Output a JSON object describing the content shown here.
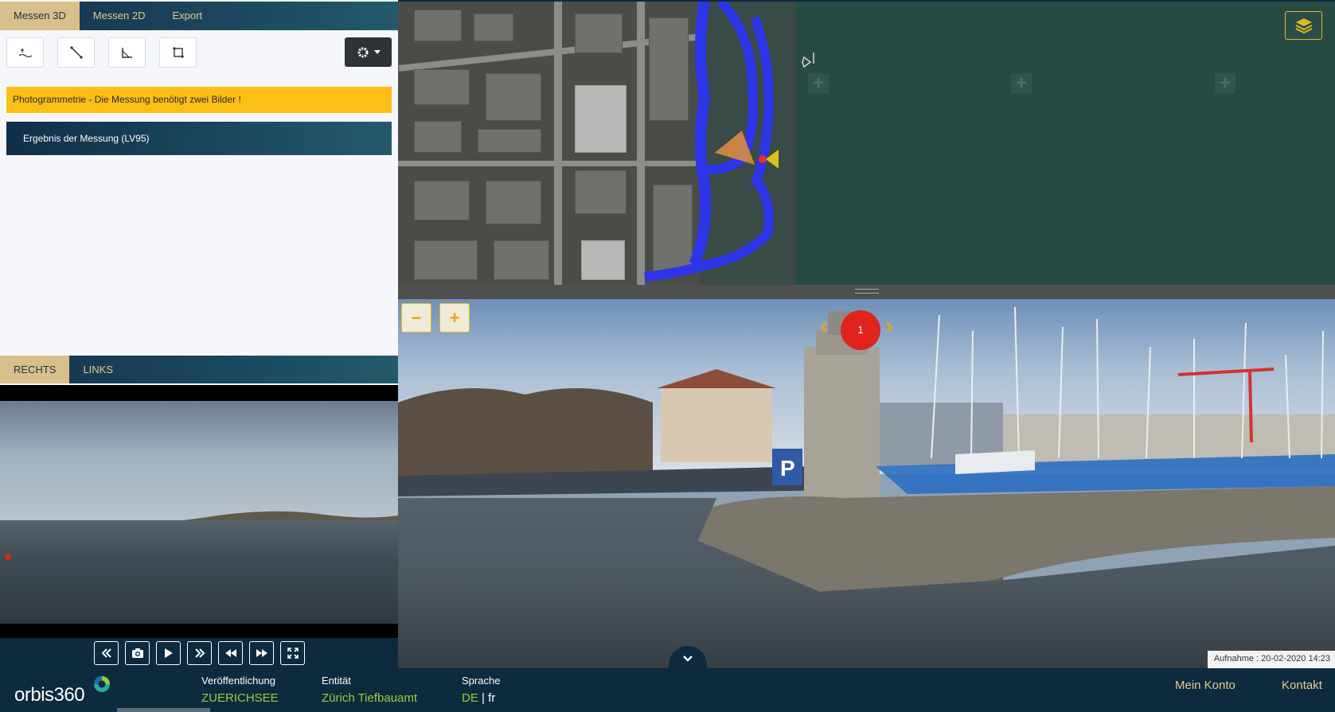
{
  "top_tabs": [
    {
      "label": "Messen 3D",
      "active": true
    },
    {
      "label": "Messen 2D",
      "active": false
    },
    {
      "label": "Export",
      "active": false
    }
  ],
  "tools": [
    "height-tool-icon",
    "distance-tool-icon",
    "angle-tool-icon",
    "area-tool-icon"
  ],
  "banner": {
    "text": "Photogrammetrie - Die Messung benötigt zwei Bilder !"
  },
  "result": {
    "title": "Ergebnis der Messung (LV95)"
  },
  "bottom_tabs": [
    {
      "label": "RECHTS",
      "active": true
    },
    {
      "label": "LINKS",
      "active": false
    }
  ],
  "pano": {
    "marker": "1",
    "zoom_out": "−",
    "zoom_in": "+",
    "caption": "Aufnahme : 20-02-2020 14:23"
  },
  "footer": {
    "logo": "orbis360",
    "veroeffentlichung": {
      "label": "Veröffentlichung",
      "value": "ZUERICHSEE"
    },
    "entitaet": {
      "label": "Entität",
      "value": "Zürich Tiefbauamt"
    },
    "sprache": {
      "label": "Sprache",
      "active": "DE",
      "sep": " | ",
      "other": "fr"
    },
    "mein_konto": "Mein Konto",
    "kontakt": "Kontakt"
  },
  "colors": {
    "accent": "#e4b81f",
    "navy": "#0d2a3f",
    "banner": "#fbbf16",
    "green": "#9ccc3a"
  }
}
